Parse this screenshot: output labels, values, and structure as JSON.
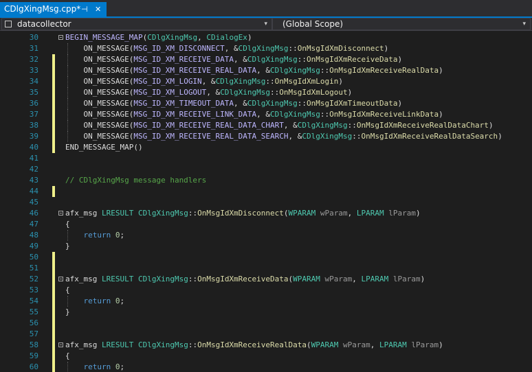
{
  "tab": {
    "title": "CDlgXingMsg.cpp*",
    "pin_glyph": "⊣",
    "close_glyph": "✕"
  },
  "navbar": {
    "project": "datacollector",
    "scope": "(Global Scope)",
    "dropdown_glyph": "▾"
  },
  "code": {
    "lines": [
      {
        "n": "30",
        "fold": true,
        "changed": false,
        "guide": false,
        "tokens": [
          [
            "k",
            "BEGIN_MESSAGE_MAP"
          ],
          [
            "p",
            "("
          ],
          [
            "c",
            "CDlgXingMsg"
          ],
          [
            "p",
            ", "
          ],
          [
            "c",
            "CDialogEx"
          ],
          [
            "p",
            ")"
          ]
        ]
      },
      {
        "n": "31",
        "fold": false,
        "changed": false,
        "guide": true,
        "tokens": [
          [
            "p",
            "    ON_MESSAGE("
          ],
          [
            "m",
            "MSG_ID_XM_DISCONNECT"
          ],
          [
            "p",
            ", &"
          ],
          [
            "c",
            "CDlgXingMsg"
          ],
          [
            "p",
            "::"
          ],
          [
            "f",
            "OnMsgIdXmDisconnect"
          ],
          [
            "p",
            ")"
          ]
        ]
      },
      {
        "n": "32",
        "fold": false,
        "changed": true,
        "guide": true,
        "tokens": [
          [
            "p",
            "    ON_MESSAGE("
          ],
          [
            "m",
            "MSG_ID_XM_RECEIVE_DATA"
          ],
          [
            "p",
            ", &"
          ],
          [
            "c",
            "CDlgXingMsg"
          ],
          [
            "p",
            "::"
          ],
          [
            "f",
            "OnMsgIdXmReceiveData"
          ],
          [
            "p",
            ")"
          ]
        ]
      },
      {
        "n": "33",
        "fold": false,
        "changed": true,
        "guide": true,
        "tokens": [
          [
            "p",
            "    ON_MESSAGE("
          ],
          [
            "m",
            "MSG_ID_XM_RECEIVE_REAL_DATA"
          ],
          [
            "p",
            ", &"
          ],
          [
            "c",
            "CDlgXingMsg"
          ],
          [
            "p",
            "::"
          ],
          [
            "f",
            "OnMsgIdXmReceiveRealData"
          ],
          [
            "p",
            ")"
          ]
        ]
      },
      {
        "n": "34",
        "fold": false,
        "changed": true,
        "guide": true,
        "tokens": [
          [
            "p",
            "    ON_MESSAGE("
          ],
          [
            "m",
            "MSG_ID_XM_LOGIN"
          ],
          [
            "p",
            ", &"
          ],
          [
            "c",
            "CDlgXingMsg"
          ],
          [
            "p",
            "::"
          ],
          [
            "f",
            "OnMsgIdXmLogin"
          ],
          [
            "p",
            ")"
          ]
        ]
      },
      {
        "n": "35",
        "fold": false,
        "changed": true,
        "guide": true,
        "tokens": [
          [
            "p",
            "    ON_MESSAGE("
          ],
          [
            "m",
            "MSG_ID_XM_LOGOUT"
          ],
          [
            "p",
            ", &"
          ],
          [
            "c",
            "CDlgXingMsg"
          ],
          [
            "p",
            "::"
          ],
          [
            "f",
            "OnMsgIdXmLogout"
          ],
          [
            "p",
            ")"
          ]
        ]
      },
      {
        "n": "36",
        "fold": false,
        "changed": true,
        "guide": true,
        "tokens": [
          [
            "p",
            "    ON_MESSAGE("
          ],
          [
            "m",
            "MSG_ID_XM_TIMEOUT_DATA"
          ],
          [
            "p",
            ", &"
          ],
          [
            "c",
            "CDlgXingMsg"
          ],
          [
            "p",
            "::"
          ],
          [
            "f",
            "OnMsgIdXmTimeoutData"
          ],
          [
            "p",
            ")"
          ]
        ]
      },
      {
        "n": "37",
        "fold": false,
        "changed": true,
        "guide": true,
        "tokens": [
          [
            "p",
            "    ON_MESSAGE("
          ],
          [
            "m",
            "MSG_ID_XM_RECEIVE_LINK_DATA"
          ],
          [
            "p",
            ", &"
          ],
          [
            "c",
            "CDlgXingMsg"
          ],
          [
            "p",
            "::"
          ],
          [
            "f",
            "OnMsgIdXmReceiveLinkData"
          ],
          [
            "p",
            ")"
          ]
        ]
      },
      {
        "n": "38",
        "fold": false,
        "changed": true,
        "guide": true,
        "tokens": [
          [
            "p",
            "    ON_MESSAGE("
          ],
          [
            "m",
            "MSG_ID_XM_RECEIVE_REAL_DATA_CHART"
          ],
          [
            "p",
            ", &"
          ],
          [
            "c",
            "CDlgXingMsg"
          ],
          [
            "p",
            "::"
          ],
          [
            "f",
            "OnMsgIdXmReceiveRealDataChart"
          ],
          [
            "p",
            ")"
          ]
        ]
      },
      {
        "n": "39",
        "fold": false,
        "changed": true,
        "guide": true,
        "tokens": [
          [
            "p",
            "    ON_MESSAGE("
          ],
          [
            "m",
            "MSG_ID_XM_RECEIVE_REAL_DATA_SEARCH"
          ],
          [
            "p",
            ", &"
          ],
          [
            "c",
            "CDlgXingMsg"
          ],
          [
            "p",
            "::"
          ],
          [
            "f",
            "OnMsgIdXmReceiveRealDataSearch"
          ],
          [
            "p",
            ")"
          ]
        ]
      },
      {
        "n": "40",
        "fold": false,
        "changed": true,
        "guide": false,
        "tokens": [
          [
            "p",
            "END_MESSAGE_MAP()"
          ]
        ]
      },
      {
        "n": "41",
        "fold": false,
        "changed": false,
        "guide": false,
        "tokens": []
      },
      {
        "n": "42",
        "fold": false,
        "changed": false,
        "guide": false,
        "tokens": []
      },
      {
        "n": "43",
        "fold": false,
        "changed": false,
        "guide": false,
        "tokens": [
          [
            "g",
            "// CDlgXingMsg message handlers"
          ]
        ]
      },
      {
        "n": "44",
        "fold": false,
        "changed": true,
        "guide": false,
        "tokens": []
      },
      {
        "n": "45",
        "fold": false,
        "changed": false,
        "guide": false,
        "tokens": []
      },
      {
        "n": "46",
        "fold": true,
        "changed": false,
        "guide": false,
        "tokens": [
          [
            "p",
            "afx_msg "
          ],
          [
            "y",
            "LRESULT"
          ],
          [
            "p",
            " "
          ],
          [
            "c",
            "CDlgXingMsg"
          ],
          [
            "p",
            "::"
          ],
          [
            "f",
            "OnMsgIdXmDisconnect"
          ],
          [
            "p",
            "("
          ],
          [
            "y",
            "WPARAM"
          ],
          [
            "p",
            " "
          ],
          [
            "r",
            "wParam"
          ],
          [
            "p",
            ", "
          ],
          [
            "y",
            "LPARAM"
          ],
          [
            "p",
            " "
          ],
          [
            "r",
            "lParam"
          ],
          [
            "p",
            ")"
          ]
        ]
      },
      {
        "n": "47",
        "fold": false,
        "changed": false,
        "guide": false,
        "tokens": [
          [
            "p",
            "{"
          ]
        ]
      },
      {
        "n": "48",
        "fold": false,
        "changed": false,
        "guide": true,
        "tokens": [
          [
            "p",
            "    "
          ],
          [
            "w",
            "return"
          ],
          [
            "p",
            " "
          ],
          [
            "n",
            "0"
          ],
          [
            "p",
            ";"
          ]
        ]
      },
      {
        "n": "49",
        "fold": false,
        "changed": false,
        "guide": false,
        "tokens": [
          [
            "p",
            "}"
          ]
        ]
      },
      {
        "n": "50",
        "fold": false,
        "changed": true,
        "guide": false,
        "tokens": []
      },
      {
        "n": "51",
        "fold": false,
        "changed": true,
        "guide": false,
        "tokens": []
      },
      {
        "n": "52",
        "fold": true,
        "changed": true,
        "guide": false,
        "tokens": [
          [
            "p",
            "afx_msg "
          ],
          [
            "y",
            "LRESULT"
          ],
          [
            "p",
            " "
          ],
          [
            "c",
            "CDlgXingMsg"
          ],
          [
            "p",
            "::"
          ],
          [
            "f",
            "OnMsgIdXmReceiveData"
          ],
          [
            "p",
            "("
          ],
          [
            "y",
            "WPARAM"
          ],
          [
            "p",
            " "
          ],
          [
            "r",
            "wParam"
          ],
          [
            "p",
            ", "
          ],
          [
            "y",
            "LPARAM"
          ],
          [
            "p",
            " "
          ],
          [
            "r",
            "lParam"
          ],
          [
            "p",
            ")"
          ]
        ]
      },
      {
        "n": "53",
        "fold": false,
        "changed": true,
        "guide": false,
        "tokens": [
          [
            "p",
            "{"
          ]
        ]
      },
      {
        "n": "54",
        "fold": false,
        "changed": true,
        "guide": true,
        "tokens": [
          [
            "p",
            "    "
          ],
          [
            "w",
            "return"
          ],
          [
            "p",
            " "
          ],
          [
            "n",
            "0"
          ],
          [
            "p",
            ";"
          ]
        ]
      },
      {
        "n": "55",
        "fold": false,
        "changed": true,
        "guide": false,
        "tokens": [
          [
            "p",
            "}"
          ]
        ]
      },
      {
        "n": "56",
        "fold": false,
        "changed": true,
        "guide": false,
        "tokens": []
      },
      {
        "n": "57",
        "fold": false,
        "changed": true,
        "guide": false,
        "tokens": []
      },
      {
        "n": "58",
        "fold": true,
        "changed": true,
        "guide": false,
        "tokens": [
          [
            "p",
            "afx_msg "
          ],
          [
            "y",
            "LRESULT"
          ],
          [
            "p",
            " "
          ],
          [
            "c",
            "CDlgXingMsg"
          ],
          [
            "p",
            "::"
          ],
          [
            "f",
            "OnMsgIdXmReceiveRealData"
          ],
          [
            "p",
            "("
          ],
          [
            "y",
            "WPARAM"
          ],
          [
            "p",
            " "
          ],
          [
            "r",
            "wParam"
          ],
          [
            "p",
            ", "
          ],
          [
            "y",
            "LPARAM"
          ],
          [
            "p",
            " "
          ],
          [
            "r",
            "lParam"
          ],
          [
            "p",
            ")"
          ]
        ]
      },
      {
        "n": "59",
        "fold": false,
        "changed": true,
        "guide": false,
        "tokens": [
          [
            "p",
            "{"
          ]
        ]
      },
      {
        "n": "60",
        "fold": false,
        "changed": true,
        "guide": true,
        "tokens": [
          [
            "p",
            "    "
          ],
          [
            "w",
            "return"
          ],
          [
            "p",
            " "
          ],
          [
            "n",
            "0"
          ],
          [
            "p",
            ";"
          ]
        ]
      }
    ]
  },
  "colors": {
    "background": "#1e1e1e",
    "accent": "#007acc",
    "line_number": "#2b91af",
    "changed_marker": "#efef8a",
    "keyword": "#569cd6",
    "class": "#4ec9b0",
    "function": "#dcdcaa",
    "comment": "#57a64a",
    "macro": "#beb7ff"
  }
}
